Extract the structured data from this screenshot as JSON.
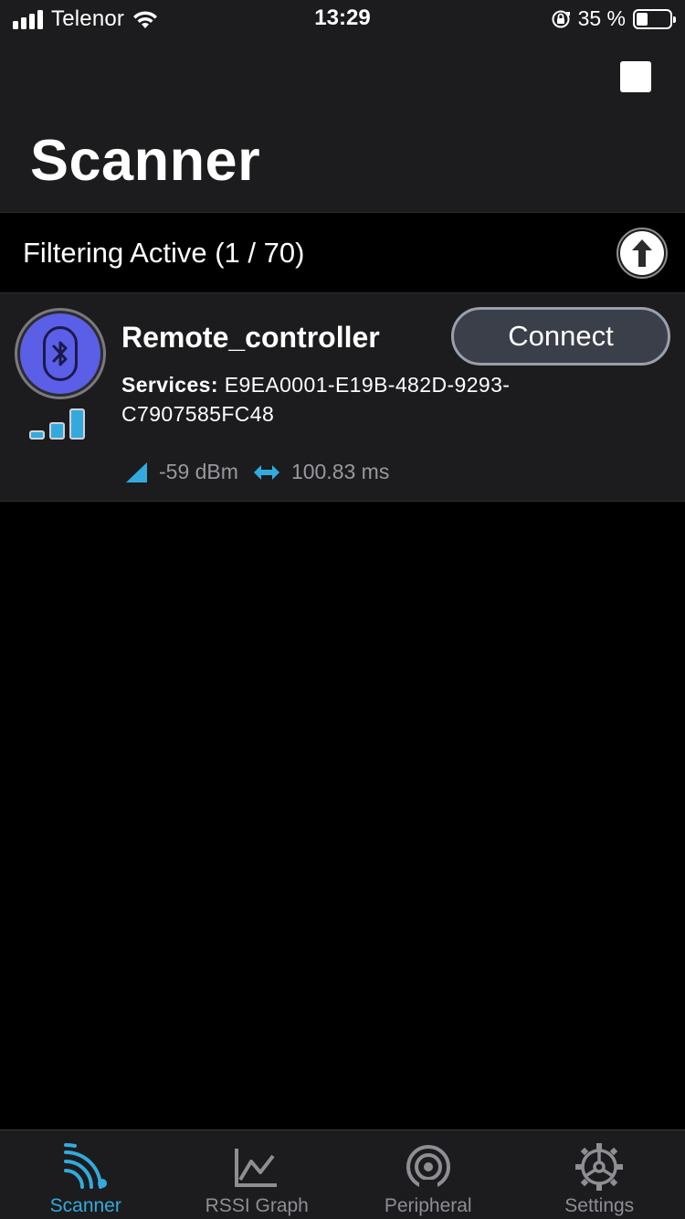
{
  "status_bar": {
    "carrier": "Telenor",
    "time": "13:29",
    "battery_percent": "35 %",
    "battery_level": 0.35
  },
  "header": {
    "title": "Scanner"
  },
  "filter": {
    "label": "Filtering Active (1 / 70)"
  },
  "devices": [
    {
      "name": "Remote_controller",
      "connect_label": "Connect",
      "services_label": "Services:",
      "services_value": "E9EA0001-E19B-482D-9293-C7907585FC48",
      "rssi": "-59 dBm",
      "interval": "100.83 ms",
      "signal_strength_bars": 3
    }
  ],
  "tabs": [
    {
      "label": "Scanner",
      "icon": "scanner-icon",
      "active": true
    },
    {
      "label": "RSSI Graph",
      "icon": "graph-icon",
      "active": false
    },
    {
      "label": "Peripheral",
      "icon": "peripheral-icon",
      "active": false
    },
    {
      "label": "Settings",
      "icon": "gear-icon",
      "active": false
    }
  ],
  "colors": {
    "accent": "#34aadc",
    "device_avatar": "#5b5ee6",
    "background": "#000000",
    "surface": "#1c1c1e"
  }
}
